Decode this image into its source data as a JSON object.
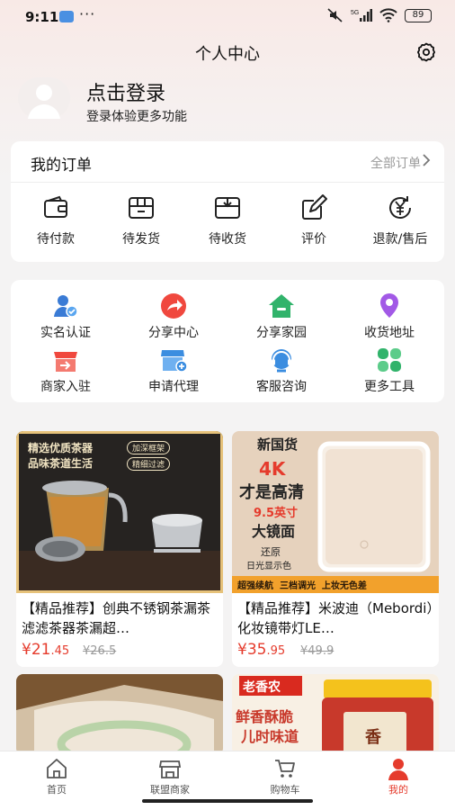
{
  "status_bar": {
    "time": "9:11",
    "dots": "···",
    "network": "5G",
    "battery": "89"
  },
  "header": {
    "title": "个人中心"
  },
  "profile": {
    "login": "点击登录",
    "subtitle": "登录体验更多功能"
  },
  "orders": {
    "title": "我的订单",
    "view_all": "全部订单",
    "items": [
      {
        "label": "待付款",
        "icon": "wallet-icon"
      },
      {
        "label": "待发货",
        "icon": "box-icon"
      },
      {
        "label": "待收货",
        "icon": "package-icon"
      },
      {
        "label": "评价",
        "icon": "edit-icon"
      },
      {
        "label": "退款/售后",
        "icon": "yen-refund-icon"
      }
    ]
  },
  "tools": [
    {
      "label": "实名认证",
      "icon": "verified-user-icon",
      "color": "#3a7bd5"
    },
    {
      "label": "分享中心",
      "icon": "share-icon",
      "color": "#f0483e"
    },
    {
      "label": "分享家园",
      "icon": "house-icon",
      "color": "#31b36b"
    },
    {
      "label": "收货地址",
      "icon": "location-icon",
      "color": "#a259e6"
    },
    {
      "label": "商家入驻",
      "icon": "shop-icon",
      "color": "#f0483e"
    },
    {
      "label": "申请代理",
      "icon": "store-add-icon",
      "color": "#3b8de0"
    },
    {
      "label": "客服咨询",
      "icon": "headset-icon",
      "color": "#3b8de0"
    },
    {
      "label": "更多工具",
      "icon": "clover-icon",
      "color": "#31b36b"
    }
  ],
  "products": [
    {
      "name": "【精品推荐】创典不锈钢茶漏茶滤滤茶器茶漏超…",
      "price_int": "¥21",
      "price_dec": ".45",
      "old_price": "¥26.5",
      "img_text": {
        "line1": "精选优质茶器",
        "line2": "品味茶道生活",
        "tag1": "加深框架",
        "tag2": "精细过滤"
      }
    },
    {
      "name": "【精品推荐】米波迪（Mebordi）化妆镜带灯LE…",
      "price_int": "¥35",
      "price_dec": ".95",
      "old_price": "¥49.9",
      "img_text": {
        "brand": "新国货",
        "k": "4K",
        "l1": "才是高清",
        "size": "9.5英寸",
        "l2": "大镜面",
        "l3": "还原",
        "l4": "日光显示色",
        "bar": "超强续航  三档调光  上妆无色差"
      }
    },
    {
      "name": "",
      "img_text": {}
    },
    {
      "name": "",
      "img_text": {
        "brand": "老香农",
        "l1": "鲜香酥脆",
        "l2": "儿时味道",
        "can": "香"
      }
    }
  ],
  "tabbar": [
    {
      "label": "首页",
      "icon": "home-icon"
    },
    {
      "label": "联盟商家",
      "icon": "store-icon"
    },
    {
      "label": "购物车",
      "icon": "cart-icon"
    },
    {
      "label": "我的",
      "icon": "user-icon"
    }
  ],
  "colors": {
    "accent": "#e53b2c",
    "background": "#f4f3f3"
  }
}
